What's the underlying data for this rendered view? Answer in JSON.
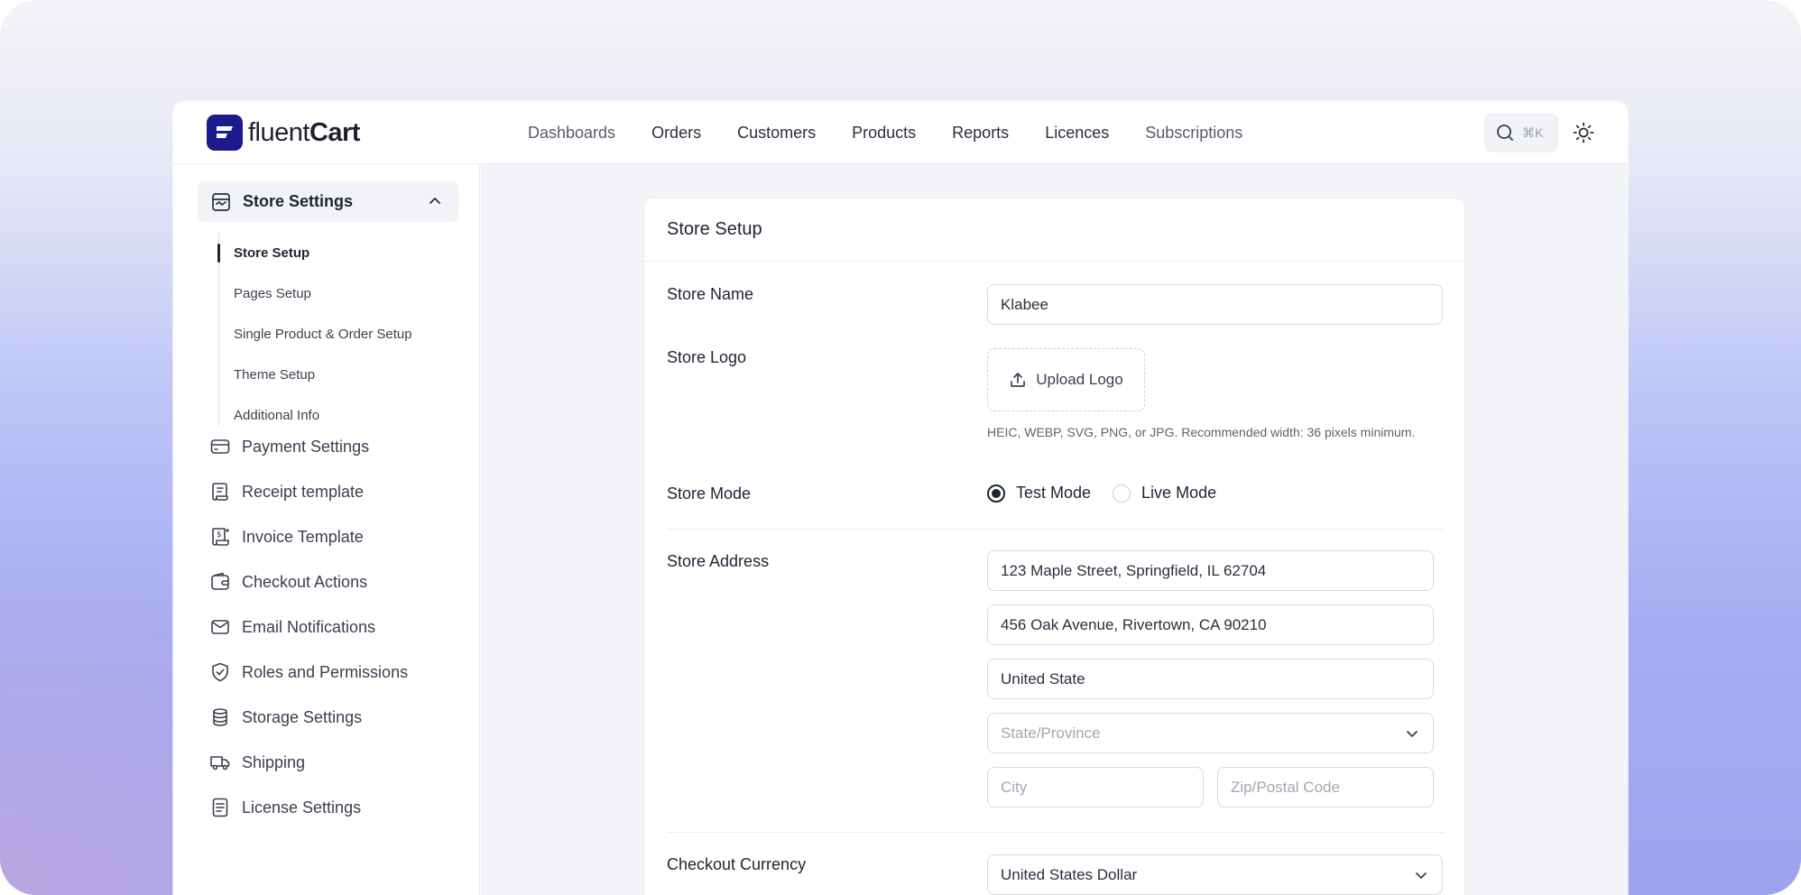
{
  "brand": {
    "name_part1": "fluent",
    "name_part2": "Cart"
  },
  "nav": {
    "items": [
      {
        "label": "Dashboards",
        "dim": true
      },
      {
        "label": "Orders",
        "dim": false
      },
      {
        "label": "Customers",
        "dim": false
      },
      {
        "label": "Products",
        "dim": false
      },
      {
        "label": "Reports",
        "dim": false
      },
      {
        "label": "Licences",
        "dim": false
      },
      {
        "label": "Subscriptions",
        "dim": true
      }
    ],
    "search_shortcut": "⌘K"
  },
  "sidebar": {
    "group": {
      "label": "Store Settings",
      "subitems": [
        {
          "label": "Store Setup",
          "active": true
        },
        {
          "label": "Pages Setup",
          "active": false
        },
        {
          "label": "Single Product & Order Setup",
          "active": false
        },
        {
          "label": "Theme Setup",
          "active": false
        },
        {
          "label": "Additional Info",
          "active": false
        }
      ]
    },
    "items": [
      {
        "label": "Payment Settings",
        "icon": "card-icon"
      },
      {
        "label": "Receipt template",
        "icon": "receipt-icon"
      },
      {
        "label": "Invoice Template",
        "icon": "invoice-icon"
      },
      {
        "label": "Checkout Actions",
        "icon": "wallet-icon"
      },
      {
        "label": "Email Notifications",
        "icon": "mail-icon"
      },
      {
        "label": "Roles and Permissions",
        "icon": "shield-icon"
      },
      {
        "label": "Storage Settings",
        "icon": "database-icon"
      },
      {
        "label": "Shipping",
        "icon": "truck-icon"
      },
      {
        "label": "License Settings",
        "icon": "document-icon"
      }
    ]
  },
  "form": {
    "title": "Store Setup",
    "store_name": {
      "label": "Store Name",
      "value": "Klabee"
    },
    "store_logo": {
      "label": "Store Logo",
      "button": "Upload Logo",
      "hint": "HEIC, WEBP, SVG, PNG, or JPG. Recommended width: 36 pixels minimum."
    },
    "store_mode": {
      "label": "Store Mode",
      "options": [
        {
          "label": "Test Mode",
          "checked": true
        },
        {
          "label": "Live Mode",
          "checked": false
        }
      ]
    },
    "store_address": {
      "label": "Store Address",
      "line1": "123 Maple Street, Springfield, IL 62704",
      "line2": "456 Oak Avenue, Rivertown, CA 90210",
      "country": "United State",
      "state_placeholder": "State/Province",
      "city_placeholder": "City",
      "zip_placeholder": "Zip/Postal Code"
    },
    "checkout_currency": {
      "label": "Checkout Currency",
      "value": "United States Dollar"
    }
  }
}
